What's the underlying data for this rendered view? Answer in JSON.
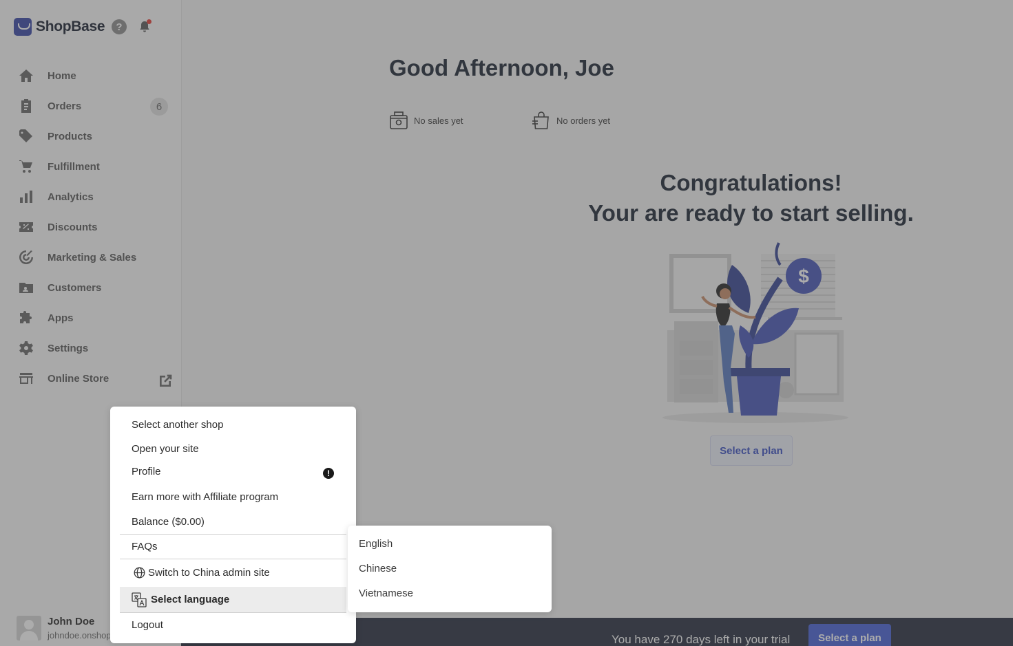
{
  "brand": {
    "name": "ShopBase",
    "color": "#3b4aa8"
  },
  "header_icons": {
    "help": "?"
  },
  "nav": {
    "items": [
      {
        "label": "Home",
        "icon": "home-icon"
      },
      {
        "label": "Orders",
        "icon": "orders-icon",
        "badge": "6"
      },
      {
        "label": "Products",
        "icon": "tag-icon"
      },
      {
        "label": "Fulfillment",
        "icon": "cart-icon"
      },
      {
        "label": "Analytics",
        "icon": "bar-chart-icon"
      },
      {
        "label": "Discounts",
        "icon": "discount-icon"
      },
      {
        "label": "Marketing & Sales",
        "icon": "target-icon"
      },
      {
        "label": "Customers",
        "icon": "customers-icon"
      },
      {
        "label": "Apps",
        "icon": "puzzle-icon"
      },
      {
        "label": "Settings",
        "icon": "gear-icon"
      },
      {
        "label": "Online Store",
        "icon": "store-icon"
      }
    ]
  },
  "user": {
    "name": "John Doe",
    "domain": "johndoe.onshop"
  },
  "main": {
    "greeting": "Good Afternoon, Joe",
    "stats": [
      {
        "label": "No sales yet",
        "icon": "cash-register-icon"
      },
      {
        "label": "No orders yet",
        "icon": "shopping-bag-icon"
      }
    ],
    "congrats_line1": "Congratulations!",
    "congrats_line2": "Your are ready to start selling.",
    "select_plan": "Select a plan"
  },
  "trial": {
    "text": "You have 270 days left in your trial",
    "button": "Select a plan",
    "accent": "#4a63d8"
  },
  "account_menu": {
    "items": [
      "Select another shop",
      "Open your site",
      "Profile",
      "Earn more with Affiliate program",
      "Balance ($0.00)",
      "FAQs",
      "Switch to China admin site",
      "Select language",
      "Logout"
    ],
    "profile_alert": "!"
  },
  "language_menu": {
    "items": [
      "English",
      "Chinese",
      "Vietnamese"
    ]
  }
}
